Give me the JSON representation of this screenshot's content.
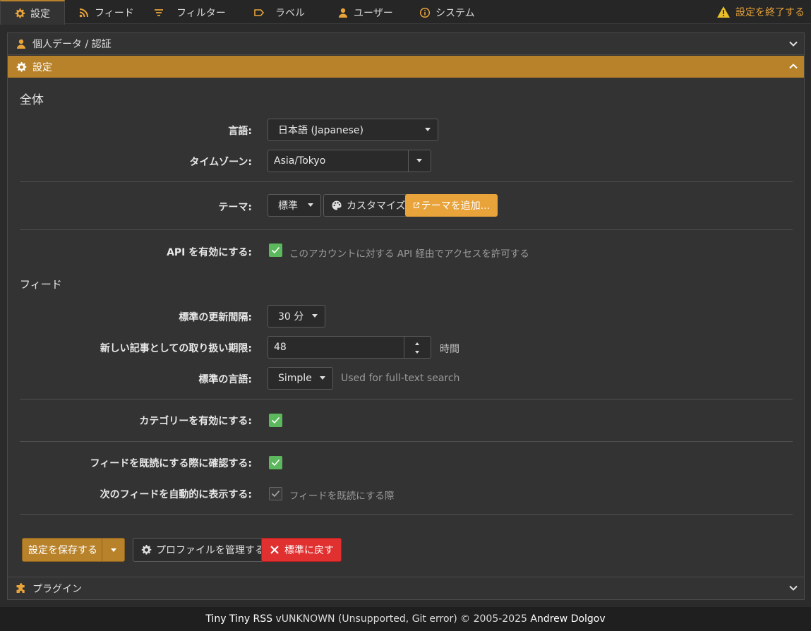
{
  "tabs": [
    {
      "label": "設定",
      "icon": "gear-icon"
    },
    {
      "label": "フィード",
      "icon": "rss-icon"
    },
    {
      "label": "フィルター",
      "icon": "filter-icon"
    },
    {
      "label": "ラベル",
      "icon": "label-icon"
    },
    {
      "label": "ユーザー",
      "icon": "user-icon"
    },
    {
      "label": "システム",
      "icon": "info-icon"
    }
  ],
  "exit_label": "設定を終了する",
  "accordion": {
    "personal": "個人データ / 認証",
    "settings": "設定",
    "plugins": "プラグイン"
  },
  "sections": {
    "general": "全体",
    "feeds": "フィード"
  },
  "fields": {
    "language": {
      "label": "言語:",
      "value": "日本語 (Japanese)"
    },
    "timezone": {
      "label": "タイムゾーン:",
      "value": "Asia/Tokyo"
    },
    "theme": {
      "label": "テーマ:",
      "value": "標準",
      "customize": "カスタマイズ",
      "add": "テーマを追加..."
    },
    "api": {
      "label": "API を有効にする:",
      "checked": true,
      "hint": "このアカウントに対する API 経由でアクセスを許可する"
    },
    "update_interval": {
      "label": "標準の更新間隔:",
      "value": "30 分"
    },
    "fresh_limit": {
      "label": "新しい記事としての取り扱い期限:",
      "value": "48",
      "unit": "時間"
    },
    "default_lang": {
      "label": "標準の言語:",
      "value": "Simple",
      "hint": "Used for full-text search"
    },
    "categories": {
      "label": "カテゴリーを有効にする:",
      "checked": true
    },
    "confirm_read": {
      "label": "フィードを既読にする際に確認する:",
      "checked": true
    },
    "auto_next": {
      "label": "次のフィードを自動的に表示する:",
      "checked": true,
      "hint": "フィードを既読にする際"
    }
  },
  "buttons": {
    "save": "設定を保存する",
    "profiles": "プロファイルを管理する",
    "reset": "標準に戻す"
  },
  "footer": {
    "app": "Tiny Tiny RSS",
    "version": " vUNKNOWN (Unsupported, Git error) © 2005-2025 ",
    "author": "Andrew Dolgov"
  },
  "colors": {
    "accent": "#b8822b",
    "accent_light": "#e8a33a",
    "check": "#5cb85c",
    "danger": "#e03030"
  }
}
